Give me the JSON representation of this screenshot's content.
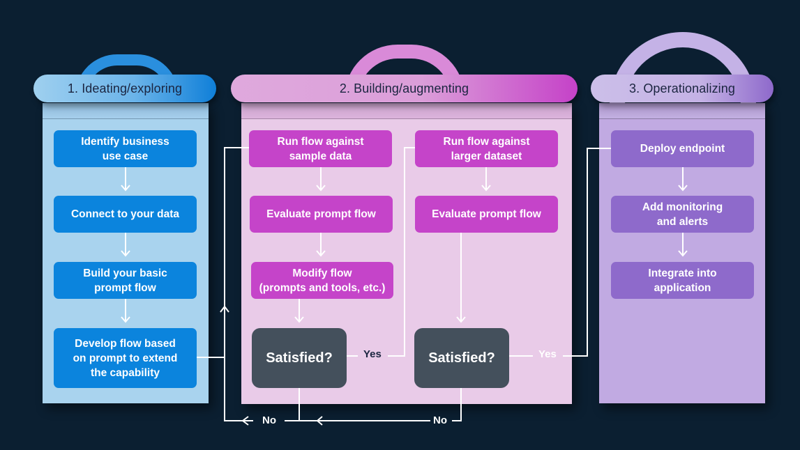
{
  "colors": {
    "background": "#0b1f31",
    "phase1": "#0b84dd",
    "phase2": "#c544c9",
    "phase3": "#8e6acb",
    "decision": "#44505c"
  },
  "phases": [
    {
      "title": "1. Ideating/exploring",
      "steps": [
        "Identify business\nuse case",
        "Connect to your data",
        "Build your basic\nprompt flow",
        "Develop flow based\non prompt to extend\nthe capability"
      ]
    },
    {
      "title": "2. Building/augmenting",
      "left_steps": [
        "Run flow against\nsample data",
        "Evaluate prompt flow",
        "Modify flow\n(prompts and tools, etc.)"
      ],
      "right_steps": [
        "Run flow against\nlarger dataset",
        "Evaluate prompt flow"
      ],
      "decisions": [
        "Satisfied?",
        "Satisfied?"
      ]
    },
    {
      "title": "3. Operationalizing",
      "steps": [
        "Deploy endpoint",
        "Add monitoring\nand alerts",
        "Integrate into\napplication"
      ]
    }
  ],
  "edge_labels": {
    "yes_1": "Yes",
    "yes_2": "Yes",
    "no_1": "No",
    "no_2": "No"
  }
}
